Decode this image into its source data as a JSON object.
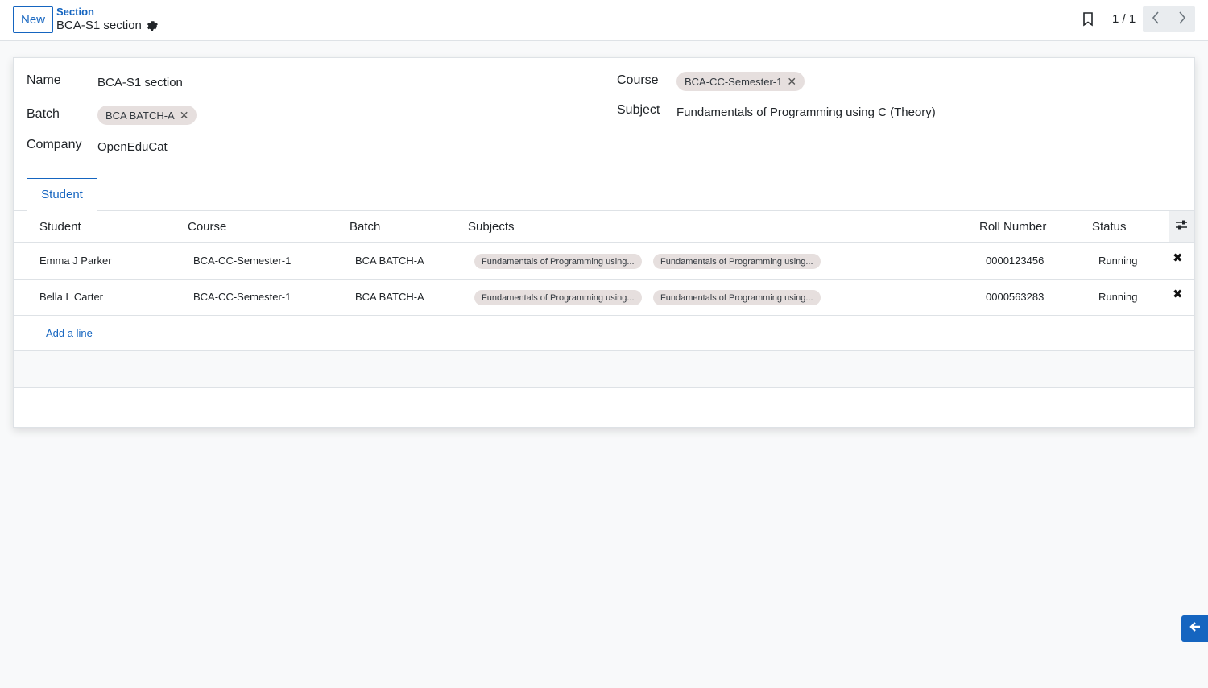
{
  "control_panel": {
    "new_label": "New",
    "breadcrumb": "Section",
    "record_title": "BCA-S1 section",
    "pager": "1 / 1"
  },
  "form": {
    "name_label": "Name",
    "name_value": "BCA-S1 section",
    "batch_label": "Batch",
    "batch_tag": "BCA BATCH-A",
    "company_label": "Company",
    "company_value": "OpenEduCat",
    "course_label": "Course",
    "course_tag": "BCA-CC-Semester-1",
    "subject_label": "Subject",
    "subject_value": "Fundamentals of Programming using C (Theory)"
  },
  "tabs": [
    {
      "label": "Student",
      "active": true
    }
  ],
  "table": {
    "headers": [
      "Student",
      "Course",
      "Batch",
      "Subjects",
      "Roll Number",
      "Status"
    ],
    "rows": [
      {
        "student": "Emma J Parker",
        "course": "BCA-CC-Semester-1",
        "batch": "BCA BATCH-A",
        "subjects": [
          "Fundamentals of Programming using...",
          "Fundamentals of Programming using..."
        ],
        "roll_number": "0000123456",
        "status": "Running"
      },
      {
        "student": "Bella L Carter",
        "course": "BCA-CC-Semester-1",
        "batch": "BCA BATCH-A",
        "subjects": [
          "Fundamentals of Programming using...",
          "Fundamentals of Programming using..."
        ],
        "roll_number": "0000563283",
        "status": "Running"
      }
    ],
    "add_line_label": "Add a line"
  },
  "colors": {
    "accent": "#1565c0",
    "tag_bg": "#e6dfde"
  },
  "icons": {
    "gear": "gear-icon",
    "bookmark": "bookmark-icon",
    "prev": "chevron-left-icon",
    "next": "chevron-right-icon",
    "optional_columns": "sliders-icon",
    "delete": "close-icon",
    "back": "arrow-left-icon"
  }
}
